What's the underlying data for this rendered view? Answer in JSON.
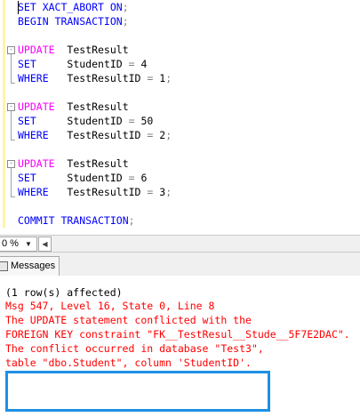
{
  "editor": {
    "lines": [
      {
        "tokens": [
          {
            "t": "SET XACT_ABORT ",
            "c": "kw"
          },
          {
            "t": "ON",
            "c": "kw"
          },
          {
            "t": ";",
            "c": "gray"
          }
        ]
      },
      {
        "tokens": [
          {
            "t": "BEGIN TRANSACTION",
            "c": "kw"
          },
          {
            "t": ";",
            "c": "gray"
          }
        ]
      },
      {
        "tokens": []
      },
      {
        "tokens": [
          {
            "t": "UPDATE",
            "c": "mag"
          },
          {
            "t": "  TestResult",
            "c": ""
          }
        ]
      },
      {
        "tokens": [
          {
            "t": "SET",
            "c": "kw"
          },
          {
            "t": "     StudentID ",
            "c": ""
          },
          {
            "t": "=",
            "c": "gray"
          },
          {
            "t": " 4",
            "c": ""
          }
        ]
      },
      {
        "tokens": [
          {
            "t": "WHERE",
            "c": "kw"
          },
          {
            "t": "   TestResultID ",
            "c": ""
          },
          {
            "t": "=",
            "c": "gray"
          },
          {
            "t": " 1",
            "c": ""
          },
          {
            "t": ";",
            "c": "gray"
          }
        ]
      },
      {
        "tokens": []
      },
      {
        "tokens": [
          {
            "t": "UPDATE",
            "c": "mag"
          },
          {
            "t": "  TestResult",
            "c": ""
          }
        ]
      },
      {
        "tokens": [
          {
            "t": "SET",
            "c": "kw"
          },
          {
            "t": "     StudentID ",
            "c": ""
          },
          {
            "t": "=",
            "c": "gray"
          },
          {
            "t": " 50",
            "c": ""
          }
        ]
      },
      {
        "tokens": [
          {
            "t": "WHERE",
            "c": "kw"
          },
          {
            "t": "   TestResultID ",
            "c": ""
          },
          {
            "t": "=",
            "c": "gray"
          },
          {
            "t": " 2",
            "c": ""
          },
          {
            "t": ";",
            "c": "gray"
          }
        ]
      },
      {
        "tokens": []
      },
      {
        "tokens": [
          {
            "t": "UPDATE",
            "c": "mag"
          },
          {
            "t": "  TestResult",
            "c": ""
          }
        ]
      },
      {
        "tokens": [
          {
            "t": "SET",
            "c": "kw"
          },
          {
            "t": "     StudentID ",
            "c": ""
          },
          {
            "t": "=",
            "c": "gray"
          },
          {
            "t": " 6",
            "c": ""
          }
        ]
      },
      {
        "tokens": [
          {
            "t": "WHERE",
            "c": "kw"
          },
          {
            "t": "   TestResultID ",
            "c": ""
          },
          {
            "t": "=",
            "c": "gray"
          },
          {
            "t": " 3",
            "c": ""
          },
          {
            "t": ";",
            "c": "gray"
          }
        ]
      },
      {
        "tokens": []
      },
      {
        "tokens": [
          {
            "t": "COMMIT TRANSACTION",
            "c": "kw"
          },
          {
            "t": ";",
            "c": "gray"
          }
        ]
      }
    ],
    "fold_markers": [
      "-",
      "-",
      "-"
    ]
  },
  "statusbar": {
    "zoom": "0 %",
    "zoom_arrow": "▼",
    "scroll_left": "◀"
  },
  "results": {
    "tab_label": "Messages",
    "messages": [
      {
        "text": "(1 row(s) affected)",
        "style": "black"
      },
      {
        "text": "Msg 547, Level 16, State 0, Line 8",
        "style": "red"
      },
      {
        "text": "The UPDATE statement conflicted with the",
        "style": "red"
      },
      {
        "text": "FOREIGN KEY constraint \"FK__TestResul__Stude__5F7E2DAC\".",
        "style": "red"
      },
      {
        "text": "The conflict occurred in database \"Test3\",",
        "style": "red"
      },
      {
        "text": "table \"dbo.Student\", column 'StudentID'.",
        "style": "red"
      }
    ]
  },
  "colors": {
    "keyword": "#0000ff",
    "update_keyword": "#ff00ff",
    "operator": "#808080",
    "error": "#ff0000",
    "highlight_box": "#1e90e6"
  }
}
